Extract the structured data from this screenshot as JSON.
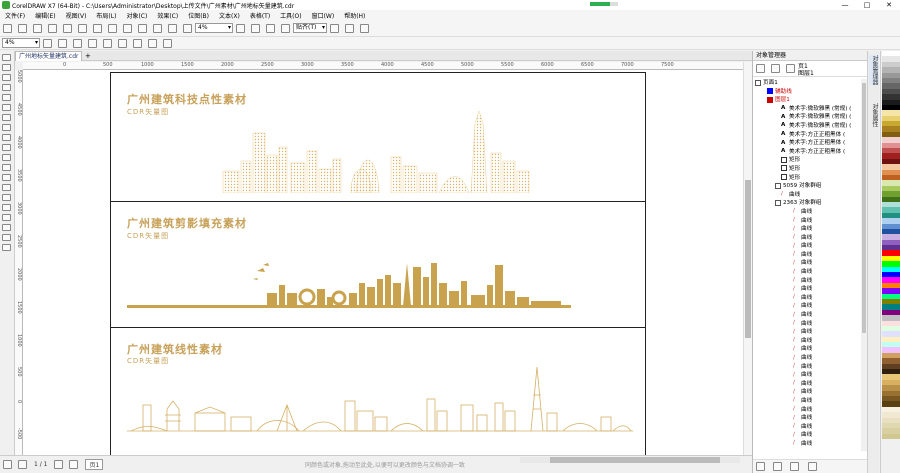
{
  "window": {
    "title": "CorelDRAW X7 (64-Bit) - C:\\Users\\Administrator\\Desktop\\上传文件\\广州素材\\广州地标矢量建筑.cdr",
    "minimize": "—",
    "maximize": "□",
    "close": "✕"
  },
  "menu": [
    "文件(F)",
    "编辑(E)",
    "视图(V)",
    "布局(L)",
    "对象(C)",
    "效果(C)",
    "位图(B)",
    "文本(X)",
    "表格(T)",
    "工具(O)",
    "窗口(W)",
    "帮助(H)"
  ],
  "toolbar": {
    "zoom_value": "4%",
    "snap_label": "贴齐(T)"
  },
  "propbar": {
    "zoom_value": "4%"
  },
  "doc_tab": {
    "label": "广州地标矢量建筑.cdr",
    "add": "+"
  },
  "ruler_h": [
    "0",
    "500",
    "1000",
    "1500",
    "2000",
    "2500",
    "3000",
    "3500",
    "4000",
    "4500",
    "5000",
    "5500",
    "6000",
    "6500",
    "7000",
    "7500"
  ],
  "ruler_v": [
    "5000",
    "4500",
    "4000",
    "3500",
    "3000",
    "2500",
    "2000",
    "1500",
    "1000",
    "500",
    "0",
    "-500"
  ],
  "sections": [
    {
      "title": "广州建筑科技点性素材",
      "subtitle": "CDR矢量图"
    },
    {
      "title": "广州建筑剪影填充素材",
      "subtitle": "CDR矢量图"
    },
    {
      "title": "广州建筑线性素材",
      "subtitle": "CDR矢量图"
    }
  ],
  "status": {
    "page": "1 / 1",
    "page_tab": "页1",
    "hint": "同颜色或对象,拖动至此处,以便可以更改颜色与文档协调一致"
  },
  "object_manager": {
    "title": "对象管理器",
    "page_label": "页1",
    "layer_label": "图层1",
    "rows": [
      {
        "label": "页面1",
        "kind": "page",
        "indent": 0
      },
      {
        "label": "辅助线",
        "kind": "guide",
        "indent": 1
      },
      {
        "label": "图层1",
        "kind": "layer",
        "indent": 1
      },
      {
        "label": "美术字:微软雅黑 (常规) (",
        "kind": "text",
        "indent": 2
      },
      {
        "label": "美术字:微软雅黑 (常规) (",
        "kind": "text",
        "indent": 2
      },
      {
        "label": "美术字:微软雅黑 (常规) (",
        "kind": "text",
        "indent": 2
      },
      {
        "label": "美术字:方正正粗黑体 (",
        "kind": "text",
        "indent": 2
      },
      {
        "label": "美术字:方正正粗黑体 (",
        "kind": "text",
        "indent": 2
      },
      {
        "label": "美术字:方正正粗黑体 (",
        "kind": "text",
        "indent": 2
      },
      {
        "label": "矩形",
        "kind": "rect",
        "indent": 2
      },
      {
        "label": "矩形",
        "kind": "rect",
        "indent": 2
      },
      {
        "label": "矩形",
        "kind": "rect",
        "indent": 2
      },
      {
        "label": "5059 对象群组",
        "kind": "group",
        "indent": 2
      },
      {
        "label": "曲线",
        "kind": "curve",
        "indent": 2
      },
      {
        "label": "2363 对象群组",
        "kind": "group",
        "indent": 2
      },
      {
        "label": "曲线",
        "kind": "curve",
        "indent": 3
      },
      {
        "label": "曲线",
        "kind": "curve",
        "indent": 3
      },
      {
        "label": "曲线",
        "kind": "curve",
        "indent": 3
      },
      {
        "label": "曲线",
        "kind": "curve",
        "indent": 3
      },
      {
        "label": "曲线",
        "kind": "curve",
        "indent": 3
      },
      {
        "label": "曲线",
        "kind": "curve",
        "indent": 3
      },
      {
        "label": "曲线",
        "kind": "curve",
        "indent": 3
      },
      {
        "label": "曲线",
        "kind": "curve",
        "indent": 3
      },
      {
        "label": "曲线",
        "kind": "curve",
        "indent": 3
      },
      {
        "label": "曲线",
        "kind": "curve",
        "indent": 3
      },
      {
        "label": "曲线",
        "kind": "curve",
        "indent": 3
      },
      {
        "label": "曲线",
        "kind": "curve",
        "indent": 3
      },
      {
        "label": "曲线",
        "kind": "curve",
        "indent": 3
      },
      {
        "label": "曲线",
        "kind": "curve",
        "indent": 3
      },
      {
        "label": "曲线",
        "kind": "curve",
        "indent": 3
      },
      {
        "label": "曲线",
        "kind": "curve",
        "indent": 3
      },
      {
        "label": "曲线",
        "kind": "curve",
        "indent": 3
      },
      {
        "label": "曲线",
        "kind": "curve",
        "indent": 3
      },
      {
        "label": "曲线",
        "kind": "curve",
        "indent": 3
      },
      {
        "label": "曲线",
        "kind": "curve",
        "indent": 3
      },
      {
        "label": "曲线",
        "kind": "curve",
        "indent": 3
      },
      {
        "label": "曲线",
        "kind": "curve",
        "indent": 3
      },
      {
        "label": "曲线",
        "kind": "curve",
        "indent": 3
      },
      {
        "label": "曲线",
        "kind": "curve",
        "indent": 3
      },
      {
        "label": "曲线",
        "kind": "curve",
        "indent": 3
      },
      {
        "label": "曲线",
        "kind": "curve",
        "indent": 3
      },
      {
        "label": "曲线",
        "kind": "curve",
        "indent": 3
      },
      {
        "label": "曲线",
        "kind": "curve",
        "indent": 3
      }
    ]
  },
  "side_tabs": [
    "对象管理器",
    "对象属性"
  ],
  "palette": [
    "#ffffff",
    "#e6e6e6",
    "#cccccc",
    "#b3b3b3",
    "#999999",
    "#808080",
    "#666666",
    "#4d4d4d",
    "#333333",
    "#1a1a1a",
    "#000000",
    "#f5e6a8",
    "#e8d070",
    "#c9a830",
    "#a88020",
    "#806010",
    "#f0d0d0",
    "#e09090",
    "#c05050",
    "#a02020",
    "#701010",
    "#f5c8a0",
    "#e09050",
    "#c06020",
    "#d8e8b0",
    "#a8c860",
    "#70a030",
    "#407018",
    "#b0e0d8",
    "#60c0b0",
    "#209080",
    "#b0d0f0",
    "#6090d0",
    "#2050a0",
    "#c8b0e0",
    "#9060c0",
    "#603090",
    "#ff0000",
    "#ffff00",
    "#00ff00",
    "#00ffff",
    "#0000ff",
    "#ff00ff",
    "#ff8000",
    "#8000ff",
    "#00ff80",
    "#808000",
    "#008080",
    "#800080",
    "#c0c0c0",
    "#ffe0e0",
    "#e0ffe0",
    "#e0e0ff",
    "#fff0c0",
    "#c0fff0",
    "#f0c0ff",
    "#d0a060",
    "#906030",
    "#604020",
    "#302010",
    "#e8c878",
    "#d8b060",
    "#b89048",
    "#987030",
    "#785820",
    "#584010",
    "#f8f0e0",
    "#f0e8d0",
    "#e8e0c0",
    "#e0d8b0",
    "#d8d0a0",
    "#d0c890"
  ],
  "colors": {
    "accent": "#c8a15a"
  }
}
